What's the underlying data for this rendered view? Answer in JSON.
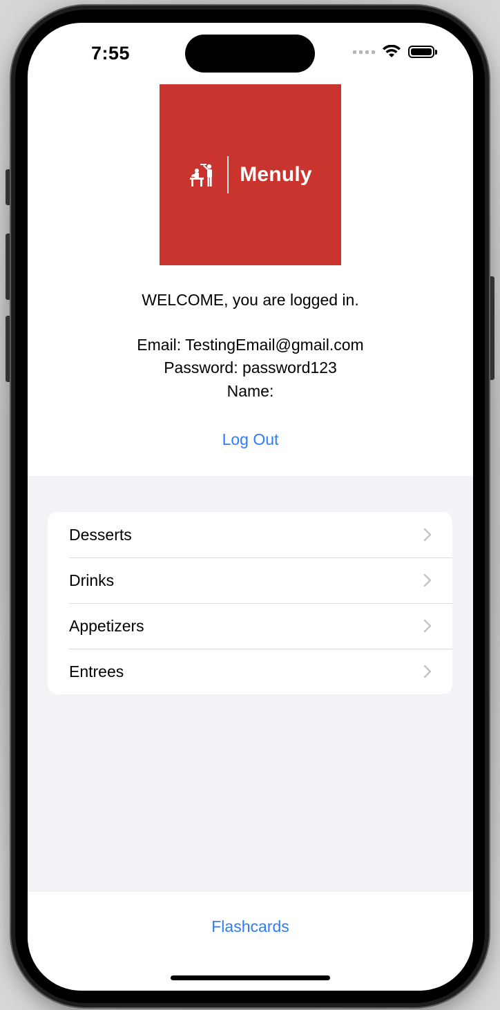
{
  "status_bar": {
    "time": "7:55"
  },
  "logo": {
    "brand_text": "Menuly",
    "icon": "waiter-serving-icon",
    "background_color": "#c9342f"
  },
  "welcome": {
    "message": "WELCOME, you are logged in."
  },
  "account": {
    "email_line": "Email: TestingEmail@gmail.com",
    "password_line": "Password: password123",
    "name_line": "Name:"
  },
  "actions": {
    "logout_label": "Log Out",
    "flashcards_label": "Flashcards"
  },
  "categories": [
    {
      "label": "Desserts"
    },
    {
      "label": "Drinks"
    },
    {
      "label": "Appetizers"
    },
    {
      "label": "Entrees"
    }
  ],
  "colors": {
    "accent": "#2f7df6",
    "grouped_background": "#f2f2f7",
    "chevron": "#c4c4c7"
  }
}
